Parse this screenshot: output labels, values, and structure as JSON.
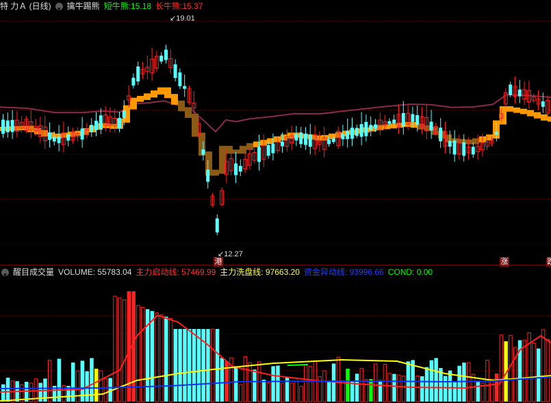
{
  "top_panel": {
    "title": "特 力Ａ (日线)",
    "indicator_name": "擒牛踢熊",
    "short_label": "短牛熊:",
    "short_value": "15.18",
    "long_label": "长牛熊:",
    "long_value": "15.37",
    "high_annotation": "19.01",
    "low_annotation": "12.27",
    "markers": [
      "港",
      "涨",
      "跌"
    ]
  },
  "bottom_panel": {
    "indicator_name": "醒目成交量",
    "volume_label": "VOLUME:",
    "volume_value": "55783.04",
    "start_label": "主力启动线:",
    "start_value": "57469.99",
    "wash_label": "主力洗盘线:",
    "wash_value": "97663.20",
    "fund_label": "资金异动线:",
    "fund_value": "93996.66",
    "cond_label": "COND:",
    "cond_value": "0.00"
  },
  "colors": {
    "background": "#000000",
    "up": "#ff2020",
    "down": "#54ffff",
    "orange": "#ff9900",
    "brown": "#8b5a14",
    "magenta_line": "#ff44aa",
    "maroon_line": "#8b2a4a",
    "yellow": "#ffff00",
    "blue": "#0033ff",
    "green": "#00ff00",
    "white": "#ffffff"
  },
  "chart_data": [
    {
      "type": "candlestick",
      "title": "特 力Ａ (日线)",
      "series": [
        {
          "name": "短牛熊",
          "last": 15.18
        },
        {
          "name": "长牛熊",
          "last": 15.37
        }
      ],
      "annotations": [
        {
          "label": "19.01",
          "kind": "high"
        },
        {
          "label": "12.27",
          "kind": "low"
        }
      ],
      "ylim": [
        12.0,
        19.3
      ]
    },
    {
      "type": "bar",
      "title": "醒目成交量",
      "series": [
        {
          "name": "VOLUME",
          "last": 55783.04
        },
        {
          "name": "主力启动线",
          "last": 57469.99
        },
        {
          "name": "主力洗盘线",
          "last": 97663.2
        },
        {
          "name": "资金异动线",
          "last": 93996.66
        },
        {
          "name": "COND",
          "last": 0.0
        }
      ]
    }
  ]
}
